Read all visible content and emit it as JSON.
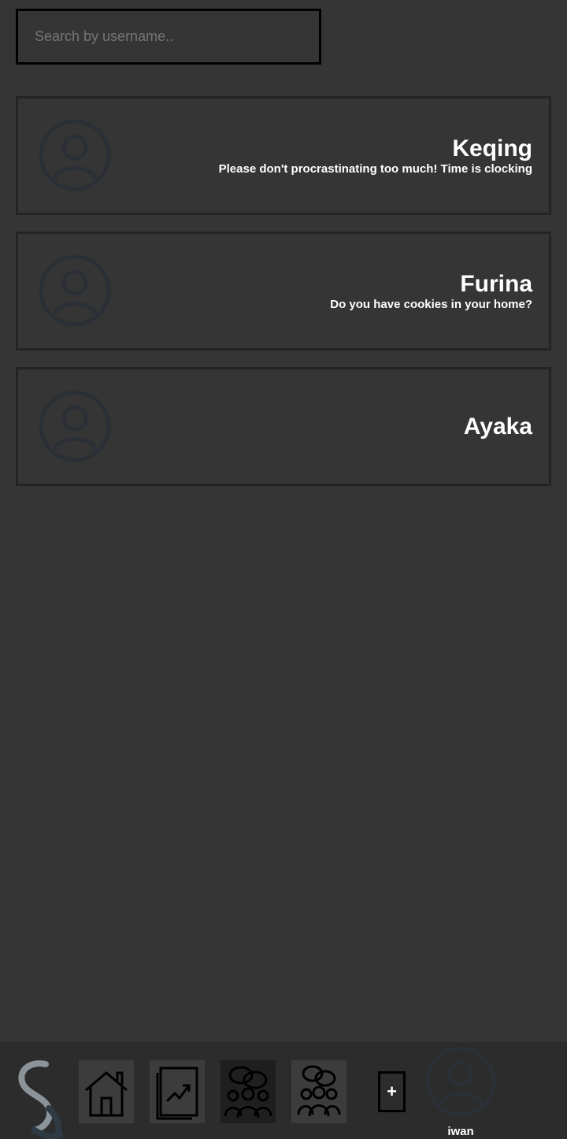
{
  "search": {
    "placeholder": "Search by username..",
    "value": ""
  },
  "chats": [
    {
      "name": "Keqing",
      "last_message": "Please don't procrastinating too much! Time is clocking"
    },
    {
      "name": "Furina",
      "last_message": "Do you have cookies in your home?"
    },
    {
      "name": "Ayaka",
      "last_message": ""
    }
  ],
  "nav": {
    "items": [
      {
        "icon": "home-icon",
        "active": false
      },
      {
        "icon": "trending-chart-icon",
        "active": false
      },
      {
        "icon": "group-chat-icon",
        "active": true
      },
      {
        "icon": "community-icon",
        "active": false
      }
    ],
    "add_label": "+",
    "profile_username": "iwan"
  },
  "colors": {
    "background": "#353535",
    "card_border": "#242424",
    "nav_background": "#2c2c2c",
    "avatar_stroke": "#2b3036",
    "logo_light": "#8a9499",
    "logo_dark": "#2e3a44"
  }
}
